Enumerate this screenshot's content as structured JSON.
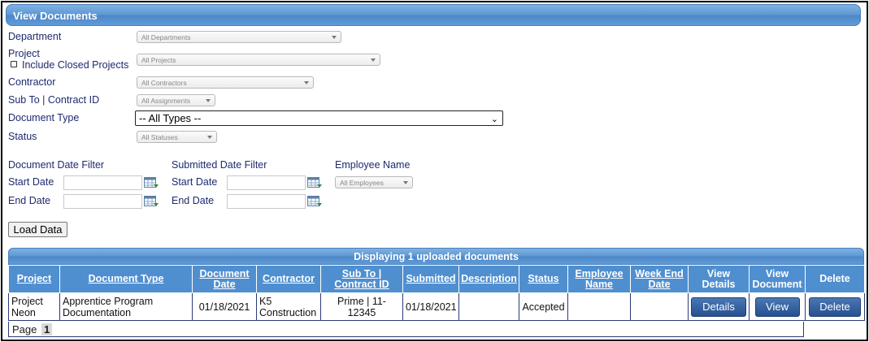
{
  "header": {
    "title": "View Documents"
  },
  "filters": {
    "department": {
      "label": "Department",
      "value": "All Departments"
    },
    "project": {
      "label": "Project",
      "value": "All Projects",
      "include_closed_label": "Include Closed Projects"
    },
    "contractor": {
      "label": "Contractor",
      "value": "All Contractors"
    },
    "sub_to": {
      "label": "Sub To | Contract ID",
      "value": "All Assignments"
    },
    "document_type": {
      "label": "Document Type",
      "value": "-- All Types --"
    },
    "status": {
      "label": "Status",
      "value": "All Statuses"
    }
  },
  "date_filters": {
    "document": {
      "title": "Document Date Filter",
      "start_label": "Start Date",
      "end_label": "End Date"
    },
    "submitted": {
      "title": "Submitted Date Filter",
      "start_label": "Start Date",
      "end_label": "End Date"
    },
    "employee": {
      "title": "Employee Name",
      "value": "All Employees"
    }
  },
  "load_button": "Load Data",
  "grid": {
    "title": "Displaying 1 uploaded documents",
    "columns": [
      {
        "label": "Project"
      },
      {
        "label": "Document Type"
      },
      {
        "label": "Document Date"
      },
      {
        "label": "Contractor"
      },
      {
        "label": "Sub To | Contract ID"
      },
      {
        "label": "Submitted"
      },
      {
        "label": "Description"
      },
      {
        "label": "Status"
      },
      {
        "label": "Employee Name"
      },
      {
        "label": "Week End Date"
      },
      {
        "label": "View Details"
      },
      {
        "label": "View Document"
      },
      {
        "label": "Delete"
      }
    ],
    "rows": [
      {
        "project": "Project Neon",
        "document_type": "Apprentice Program Documentation",
        "document_date": "01/18/2021",
        "contractor": "K5 Construction",
        "sub_to": "Prime | 11-12345",
        "submitted": "01/18/2021",
        "description": "",
        "status": "Accepted",
        "employee_name": "",
        "week_end_date": "",
        "details_label": "Details",
        "view_label": "View",
        "delete_label": "Delete"
      }
    ]
  },
  "pager": {
    "label": "Page",
    "current": "1"
  },
  "icons": {
    "calendar": "calendar-icon",
    "dropdown": "chevron-down-icon"
  },
  "colors": {
    "accent": "#5d97d4",
    "label": "#1e2a6e",
    "button": "#26508f"
  }
}
